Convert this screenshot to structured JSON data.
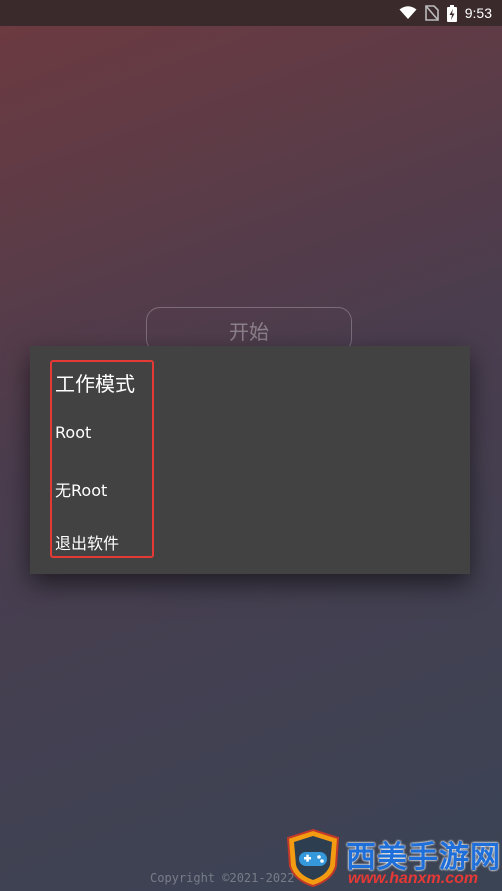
{
  "status_bar": {
    "time": "9:53",
    "icons": [
      "wifi-icon",
      "no-sim-icon",
      "battery-charging-icon"
    ]
  },
  "main": {
    "start_button_label": "开始",
    "copyright": "Copyright ©2021-2022 GG"
  },
  "dialog": {
    "title": "工作模式",
    "items": [
      {
        "label": "Root"
      },
      {
        "label": "无Root"
      },
      {
        "label": "退出软件"
      }
    ]
  },
  "watermark": {
    "title": "西美手游网",
    "url": "www.hanxm.com"
  },
  "colors": {
    "dialog_bg": "#424242",
    "highlight": "#e53935",
    "watermark_blue": "#1e6fd9",
    "watermark_red": "#e53935"
  }
}
